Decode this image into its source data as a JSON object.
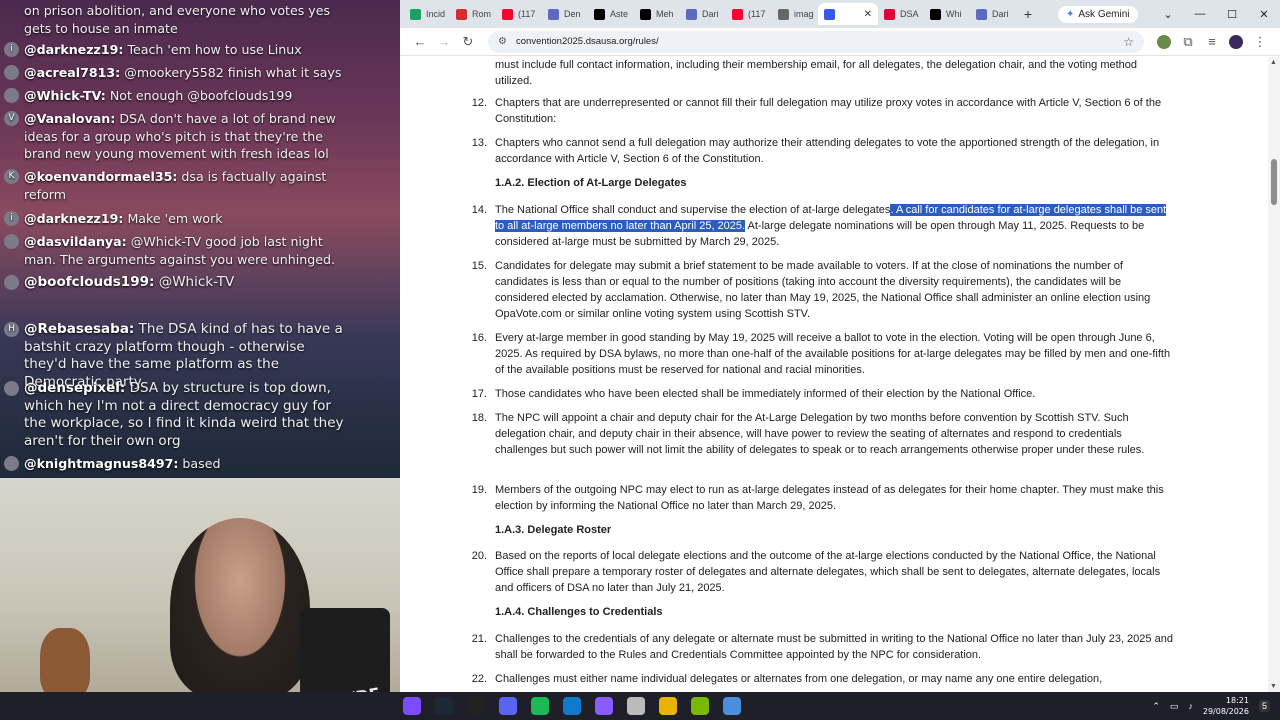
{
  "chat": {
    "messages": [
      {
        "user": "",
        "text": "on prison abolition, and everyone who votes yes gets to house an inmate"
      },
      {
        "badge": "i",
        "user": "@darknezz19:",
        "text": "Teach 'em how to use Linux"
      },
      {
        "badge": "",
        "user": "@acreal7813:",
        "text": "@mookery5582 finish what it says"
      },
      {
        "badge": "",
        "user": "@Whick-TV:",
        "text": "Not enough @boofclouds199"
      },
      {
        "badge": "V",
        "user": "@Vanalovan:",
        "text": "DSA don't have a lot of brand new ideas for a group who's pitch is that they're the brand new young movement with fresh ideas lol"
      },
      {
        "badge": "K",
        "user": "@koenvandormael35:",
        "text": "dsa is factually against reform"
      },
      {
        "badge": "i",
        "user": "@darknezz19:",
        "text": "Make 'em work"
      },
      {
        "badge": "",
        "user": "@dasvildanya:",
        "text": "@Whick-TV good job last night man. The arguments against you were unhinged."
      },
      {
        "badge": "",
        "user": "@boofclouds199:",
        "text": "@Whick-TV",
        "big": true
      },
      {
        "badge": "H",
        "user": "@Rebasesaba:",
        "text": "The DSA kind of has to have a batshit crazy platform though - otherwise they'd have the same platform as the Democratic party",
        "big": true
      },
      {
        "badge": "",
        "user": "@densepixel:",
        "text": "DSA by structure is top down, which hey I'm not a direct democracy guy for the workplace, so I find it kinda weird that they aren't for their own org",
        "big": true
      },
      {
        "badge": "",
        "user": "@knightmagnus8497:",
        "text": "based"
      }
    ]
  },
  "webcam": {
    "mic_brand": "RØDE"
  },
  "browser": {
    "tabs": [
      {
        "label": "Incid",
        "color": "#1aa260"
      },
      {
        "label": "Rom",
        "color": "#d32f2f"
      },
      {
        "label": "(117",
        "color": "#ff0033"
      },
      {
        "label": "Den",
        "color": "#5c6bc0"
      },
      {
        "label": "Aste",
        "color": "#000000"
      },
      {
        "label": "Meh",
        "color": "#000000"
      },
      {
        "label": "Dari",
        "color": "#5c6bc0"
      },
      {
        "label": "(117",
        "color": "#ff0033"
      },
      {
        "label": "imag",
        "color": "#666666"
      },
      {
        "label": "",
        "color": "#3858e9",
        "active": true
      },
      {
        "label": "DSA",
        "color": "#e0003a"
      },
      {
        "label": "Whi",
        "color": "#000000"
      },
      {
        "label": "Dari",
        "color": "#5c6bc0"
      }
    ],
    "new_tab": "+",
    "gemini": "Ask Gemini",
    "url": "convention2025.dsausa.org/rules/"
  },
  "page": {
    "items": [
      {
        "num": "",
        "html": "must include full contact information, including their membership email, for all delegates, the delegation chair, and the voting method utilized."
      },
      {
        "num": "12.",
        "html": "Chapters that are underrepresented or cannot fill their full delegation may utilize proxy votes in accordance with Article V, Section 6 of the Constitution:"
      },
      {
        "num": "13.",
        "html": "Chapters who cannot send a full delegation may authorize their attending delegates to vote the apportioned strength of the delegation, in accordance with Article V, Section 6 of the Constitution."
      },
      {
        "section": "1.A.2. Election of At-Large Delegates"
      },
      {
        "num": "14.",
        "pre": "The National Office shall conduct and supervise the election of at-large delegates",
        "highlight": ". A call for candidates for at-large delegates shall be sent to all at-large members no later than April 25, 2025.",
        "post": " At-large delegate nominations will be open through May 11, 2025. Requests to be considered at-large must be submitted by March 29, 2025."
      },
      {
        "num": "15.",
        "html": "Candidates for delegate may submit a brief statement to be made available to voters. If at the close of nominations the number of candidates is less than or equal to the number of positions (taking into account the diversity requirements), the candidates will be considered elected by acclamation. Otherwise, no later than May 19, 2025, the National Office shall administer an online election using OpaVote.com or similar online voting system using Scottish STV."
      },
      {
        "num": "16.",
        "html": "Every at-large member in good standing by May 19, 2025 will receive a ballot to vote in the election. Voting will be open through June 6, 2025. As required by DSA bylaws, no more than one-half of the available positions for at-large delegates may be filled by men and one-fifth of the available positions must be reserved for national and racial minorities."
      },
      {
        "num": "17.",
        "html": "Those candidates who have been elected shall be immediately informed of their election by the National Office."
      },
      {
        "num": "18.",
        "html": "The NPC will appoint a chair and deputy chair for the At-Large Delegation by two months before convention by Scottish STV. Such delegation chair, and deputy chair in their absence, will have power to review the seating of alternates and respond to credentials challenges but such power will not limit the ability of delegates to speak or to reach arrangements otherwise proper under these rules."
      },
      {
        "num": "19.",
        "html": "Members of the outgoing NPC may elect to run as at-large delegates instead of as delegates for their home chapter. They must make this election by informing the National Office no later than March 29, 2025."
      },
      {
        "section": "1.A.3. Delegate Roster"
      },
      {
        "num": "20.",
        "html": "Based on the reports of local delegate elections and the outcome of the at-large elections conducted by the National Office, the National Office shall prepare a temporary roster of delegates and alternate delegates, which shall be sent to delegates, alternate delegates, locals  and officers of DSA no later than July 21, 2025."
      },
      {
        "section": "1.A.4. Challenges to Credentials"
      },
      {
        "num": "21.",
        "html": "Challenges to the credentials of any delegate or alternate must be submitted in writing to the National Office no later than July 23, 2025 and shall be forwarded to the Rules and Credentials Committee appointed by the NPC for consideration."
      },
      {
        "num": "22.",
        "html": "Challenges must either name individual delegates or alternates from one delegation, or may name any one entire delegation,"
      }
    ]
  },
  "taskbar": {
    "time": "18:21",
    "date": "29/08/2026",
    "notif": "5",
    "apps": [
      {
        "name": "app-1",
        "color": "#7b4dff"
      },
      {
        "name": "steam",
        "color": "#1b2838"
      },
      {
        "name": "obs",
        "color": "#222222"
      },
      {
        "name": "discord",
        "color": "#5865f2"
      },
      {
        "name": "spotify",
        "color": "#1db954"
      },
      {
        "name": "vscode",
        "color": "#0e7acb"
      },
      {
        "name": "app-7",
        "color": "#8a5cff"
      },
      {
        "name": "app-8",
        "color": "#bbbbbb"
      },
      {
        "name": "chrome",
        "color": "#e8b400"
      },
      {
        "name": "nvidia",
        "color": "#76b900"
      },
      {
        "name": "app-11",
        "color": "#4a8fdb"
      }
    ]
  }
}
